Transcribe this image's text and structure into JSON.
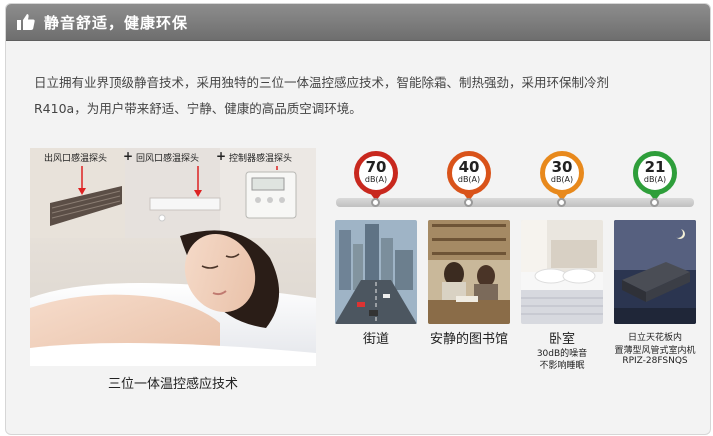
{
  "header": {
    "title": "静音舒适，健康环保",
    "icon": "thumbs-up-icon"
  },
  "description": {
    "line1": "日立拥有业界顶级静音技术，采用独特的三位一体温控感应技术，智能除霜、制热强劲，采用环保制冷剂",
    "line2": "R410a，为用户带来舒适、宁静、健康的高品质空调环境。"
  },
  "left_panel": {
    "sensor_labels": [
      "出风口感温探头",
      "回风口感温探头",
      "控制器感温探头"
    ],
    "plus": "+",
    "caption": "三位一体温控感应技术"
  },
  "noise_levels": [
    {
      "value": "70",
      "unit": "dB(A)",
      "color": "#c8281e",
      "scene": "street-scene",
      "label": "街道"
    },
    {
      "value": "40",
      "unit": "dB(A)",
      "color": "#d9531a",
      "scene": "library-scene",
      "label": "安静的图书馆"
    },
    {
      "value": "30",
      "unit": "dB(A)",
      "color": "#e8891c",
      "scene": "bedroom-scene",
      "label": "卧室",
      "sublabel1": "30dB的噪音",
      "sublabel2": "不影响睡眠"
    },
    {
      "value": "21",
      "unit": "dB(A)",
      "color": "#2e9e3a",
      "scene": "product-scene",
      "label": "日立天花板内",
      "sublabel1": "置薄型风管式室内机",
      "sublabel2": "RPIZ-28FSNQS"
    }
  ],
  "colors": {
    "header_bg": "#7f7f7f",
    "panel_bg": "#f3f3f3",
    "scale_bar": "#cccccc"
  }
}
